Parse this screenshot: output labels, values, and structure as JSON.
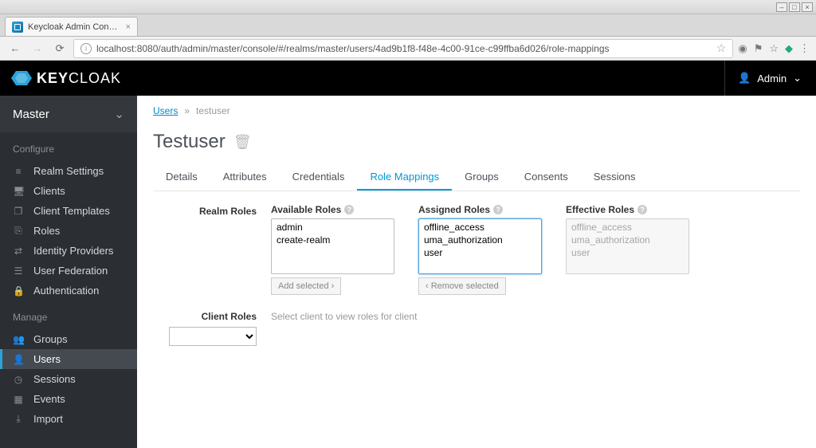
{
  "window": {
    "title": "Keycloak Admin Con…"
  },
  "browser": {
    "url": "localhost:8080/auth/admin/master/console/#/realms/master/users/4ad9b1f8-f48e-4c00-91ce-c99ffba6d026/role-mappings"
  },
  "header": {
    "brand_prefix": "KEY",
    "brand_suffix": "CLOAK",
    "user_label": "Admin"
  },
  "sidebar": {
    "realm": "Master",
    "section_configure": "Configure",
    "section_manage": "Manage",
    "configure_items": [
      {
        "label": "Realm Settings",
        "icon": "sliders"
      },
      {
        "label": "Clients",
        "icon": "desktop"
      },
      {
        "label": "Client Templates",
        "icon": "puzzle"
      },
      {
        "label": "Roles",
        "icon": "tag"
      },
      {
        "label": "Identity Providers",
        "icon": "exchange"
      },
      {
        "label": "User Federation",
        "icon": "database"
      },
      {
        "label": "Authentication",
        "icon": "lock"
      }
    ],
    "manage_items": [
      {
        "label": "Groups",
        "icon": "group",
        "active": false
      },
      {
        "label": "Users",
        "icon": "user",
        "active": true
      },
      {
        "label": "Sessions",
        "icon": "clock",
        "active": false
      },
      {
        "label": "Events",
        "icon": "calendar",
        "active": false
      },
      {
        "label": "Import",
        "icon": "import",
        "active": false
      }
    ]
  },
  "breadcrumb": {
    "root": "Users",
    "sep": "»",
    "current": "testuser"
  },
  "page": {
    "title": "Testuser"
  },
  "tabs": {
    "items": [
      {
        "label": "Details",
        "active": false
      },
      {
        "label": "Attributes",
        "active": false
      },
      {
        "label": "Credentials",
        "active": false
      },
      {
        "label": "Role Mappings",
        "active": true
      },
      {
        "label": "Groups",
        "active": false
      },
      {
        "label": "Consents",
        "active": false
      },
      {
        "label": "Sessions",
        "active": false
      }
    ]
  },
  "roles": {
    "realm_label": "Realm Roles",
    "client_label": "Client Roles",
    "client_placeholder": "Select client to view roles for client",
    "available": {
      "label": "Available Roles",
      "options": [
        "admin",
        "create-realm"
      ],
      "button": "Add selected ›"
    },
    "assigned": {
      "label": "Assigned Roles",
      "options": [
        "offline_access",
        "uma_authorization",
        "user"
      ],
      "button": "‹ Remove selected"
    },
    "effective": {
      "label": "Effective Roles",
      "options": [
        "offline_access",
        "uma_authorization",
        "user"
      ]
    }
  },
  "icons": {
    "sliders": "≡",
    "desktop": "🖥",
    "puzzle": "❐",
    "tag": "⎘",
    "exchange": "⇄",
    "database": "☰",
    "lock": "🔒",
    "group": "👥",
    "user": "👤",
    "clock": "◷",
    "calendar": "▦",
    "import": "⤓"
  }
}
